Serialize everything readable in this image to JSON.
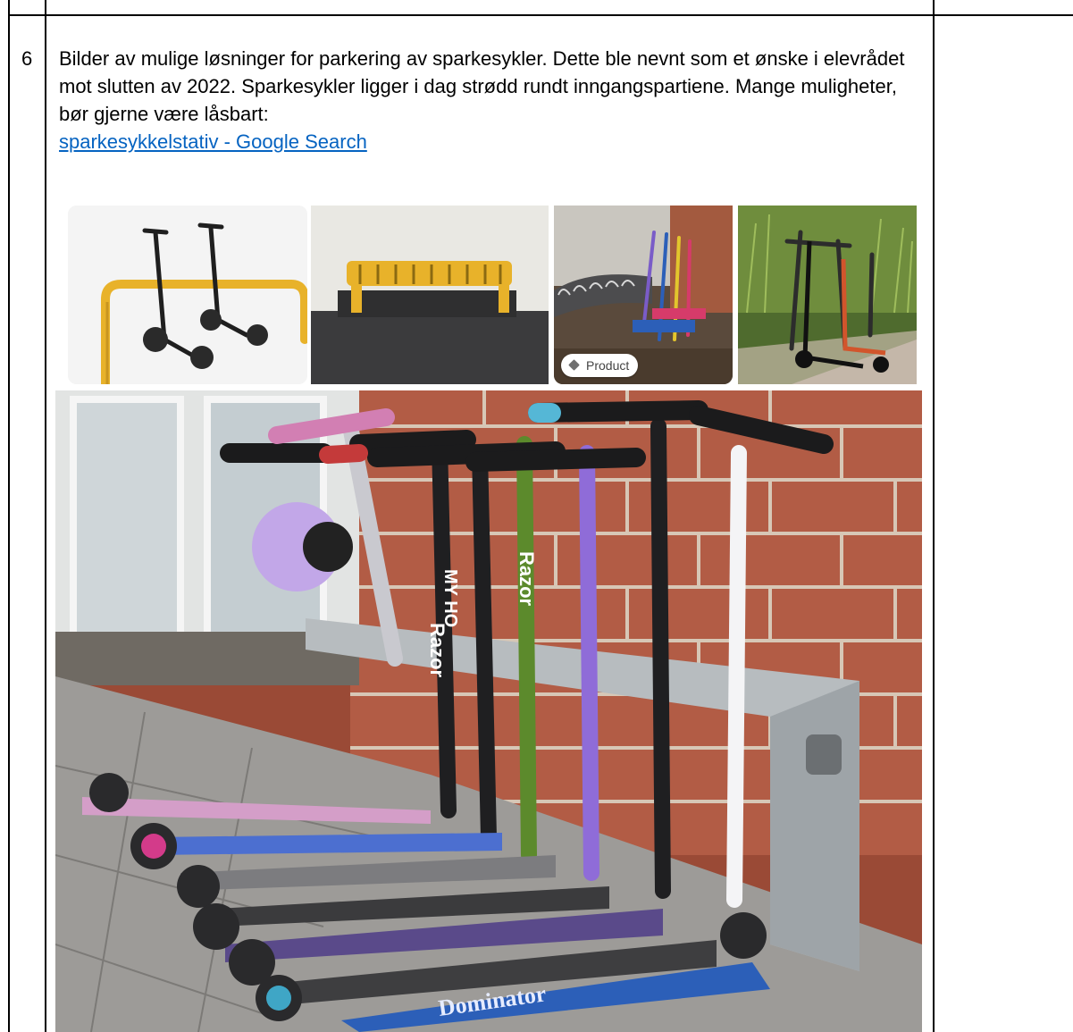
{
  "row": {
    "number": "6",
    "paragraph": "Bilder av mulige løsninger for parkering av sparkesykler. Dette ble nevnt som et ønske i elevrådet mot slutten av 2022. Sparkesykler ligger i dag strødd rundt inngangspartiene. Mange muligheter, bør gjerne være låsbart:",
    "link_text": "sparkesykkelstativ - Google Search"
  },
  "images": {
    "thumb_3_badge": "Product",
    "main_photo_scooter_labels": [
      "Razor",
      "MY HO",
      "Razor",
      "Dominator"
    ]
  },
  "colors": {
    "link": "#0563c1",
    "brick": "#a4533e",
    "rack_yellow": "#e8b22a"
  }
}
